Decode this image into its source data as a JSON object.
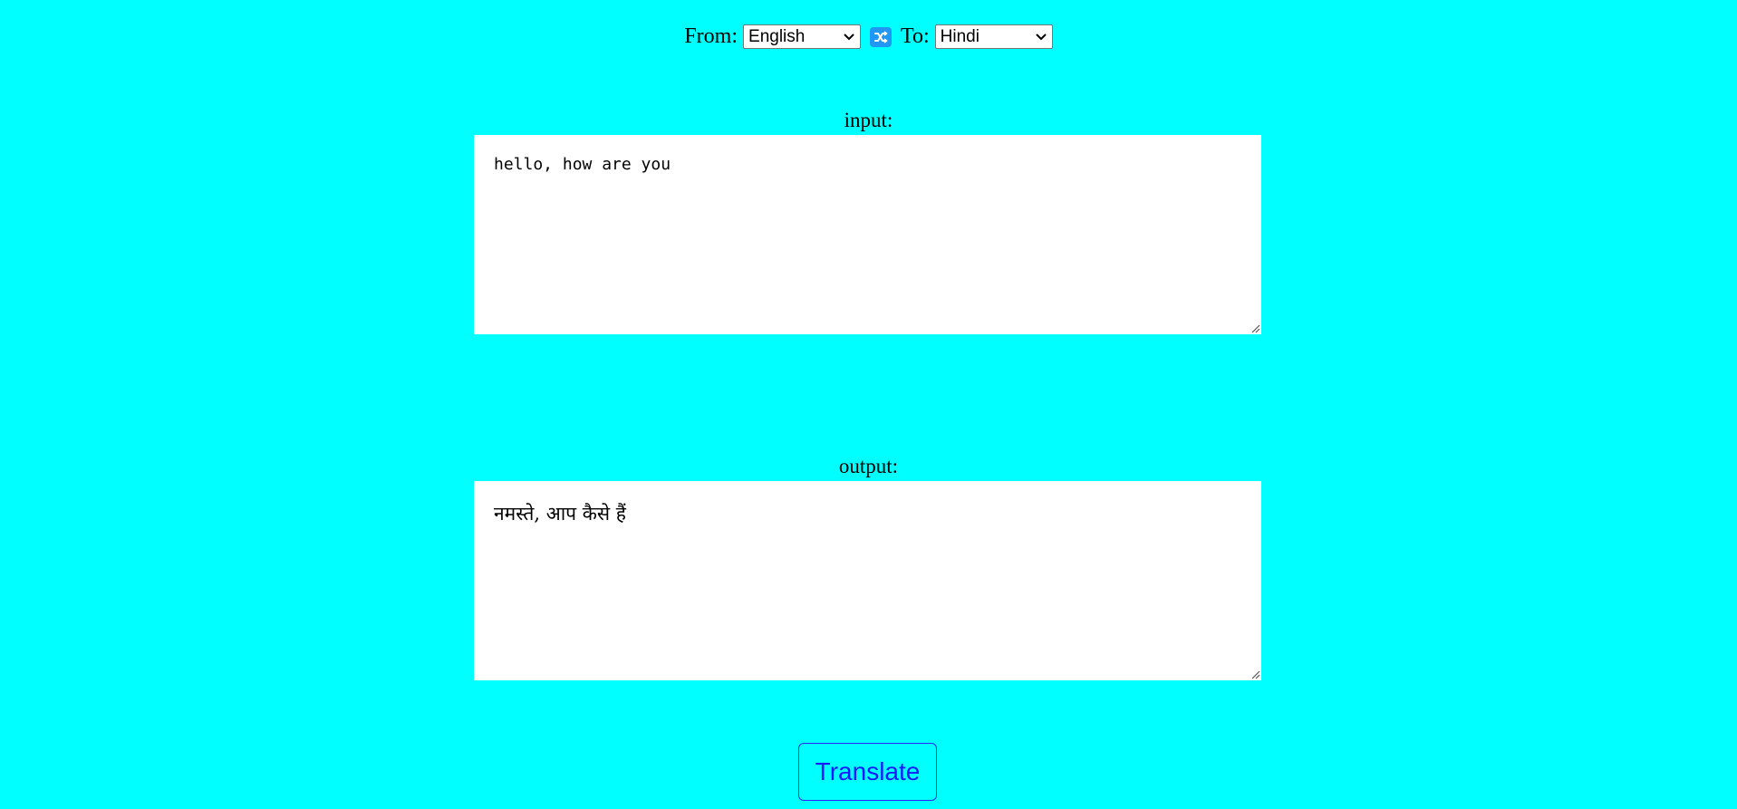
{
  "language_bar": {
    "from_label": "From:",
    "from_selected": "English",
    "swap_icon": "shuffle-icon",
    "to_label": "To:",
    "to_selected": "Hindi"
  },
  "input": {
    "label": "input:",
    "value": "hello, how are you"
  },
  "output": {
    "label": "output:",
    "value": "नमस्ते, आप कैसे हैं"
  },
  "translate_button": {
    "label": "Translate"
  },
  "colors": {
    "background": "#00ffff",
    "swap_button": "#2196f3",
    "translate_text": "#1a1aff"
  }
}
